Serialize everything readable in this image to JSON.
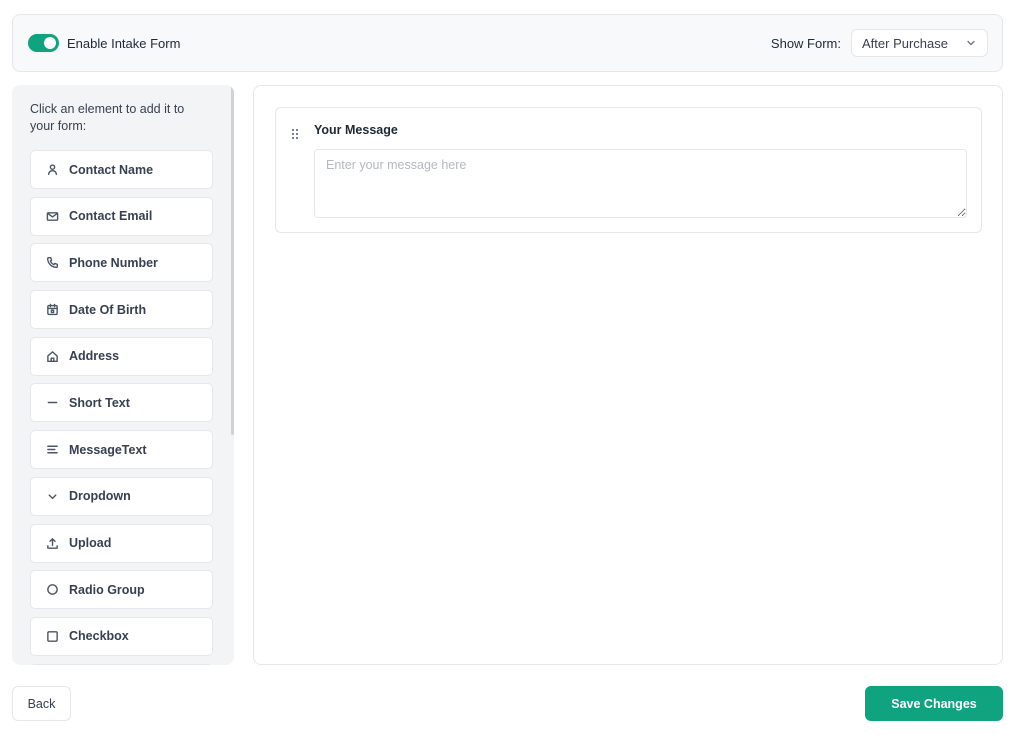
{
  "header": {
    "toggle_label": "Enable Intake Form",
    "toggle_on": true,
    "show_form_label": "Show Form:",
    "show_form_value": "After Purchase"
  },
  "sidebar": {
    "intro": "Click an element to add it to your form:",
    "items": [
      {
        "label": "Contact Name",
        "icon": "user-icon"
      },
      {
        "label": "Contact Email",
        "icon": "mail-icon"
      },
      {
        "label": "Phone Number",
        "icon": "phone-icon"
      },
      {
        "label": "Date Of Birth",
        "icon": "calendar-icon"
      },
      {
        "label": "Address",
        "icon": "home-icon"
      },
      {
        "label": "Short Text",
        "icon": "minus-icon"
      },
      {
        "label": "MessageText",
        "icon": "align-left-icon"
      },
      {
        "label": "Dropdown",
        "icon": "chevron-down-icon"
      },
      {
        "label": "Upload",
        "icon": "upload-icon"
      },
      {
        "label": "Radio Group",
        "icon": "circle-icon"
      },
      {
        "label": "Checkbox",
        "icon": "square-icon"
      }
    ]
  },
  "canvas": {
    "fields": [
      {
        "label": "Your Message",
        "placeholder": "Enter your message here",
        "value": ""
      }
    ]
  },
  "footer": {
    "back_label": "Back",
    "save_label": "Save Changes"
  },
  "colors": {
    "accent": "#10a37f",
    "border": "#e5e7eb",
    "sidebar_bg": "#f3f4f6"
  }
}
